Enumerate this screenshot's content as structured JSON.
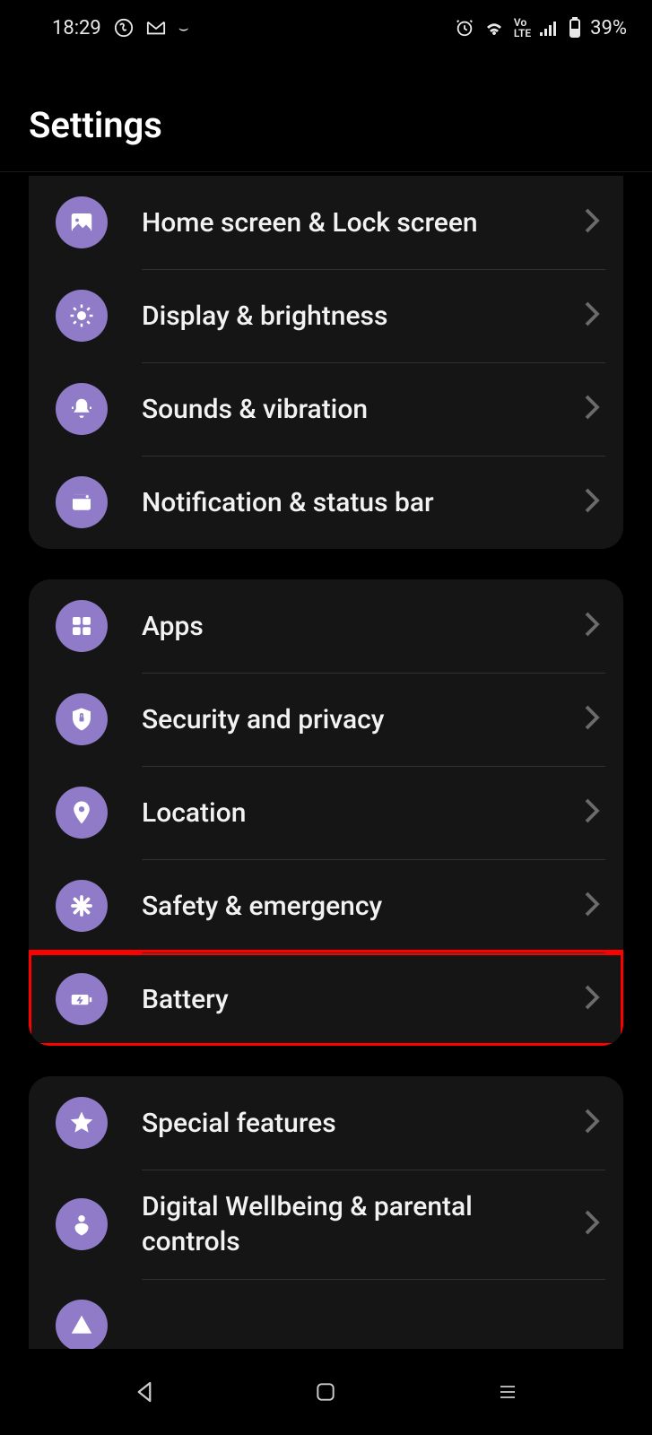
{
  "status_bar": {
    "time": "18:29",
    "battery_text": "39%"
  },
  "page_title": "Settings",
  "groups": [
    {
      "rows": [
        {
          "label": "Home screen & Lock screen"
        },
        {
          "label": "Display & brightness"
        },
        {
          "label": "Sounds & vibration"
        },
        {
          "label": "Notification & status bar"
        }
      ]
    },
    {
      "rows": [
        {
          "label": "Apps"
        },
        {
          "label": "Security and privacy"
        },
        {
          "label": "Location"
        },
        {
          "label": "Safety & emergency"
        },
        {
          "label": "Battery"
        }
      ]
    },
    {
      "rows": [
        {
          "label": "Special features"
        },
        {
          "label": "Digital Wellbeing & parental controls"
        }
      ]
    }
  ],
  "highlighted": "Battery"
}
